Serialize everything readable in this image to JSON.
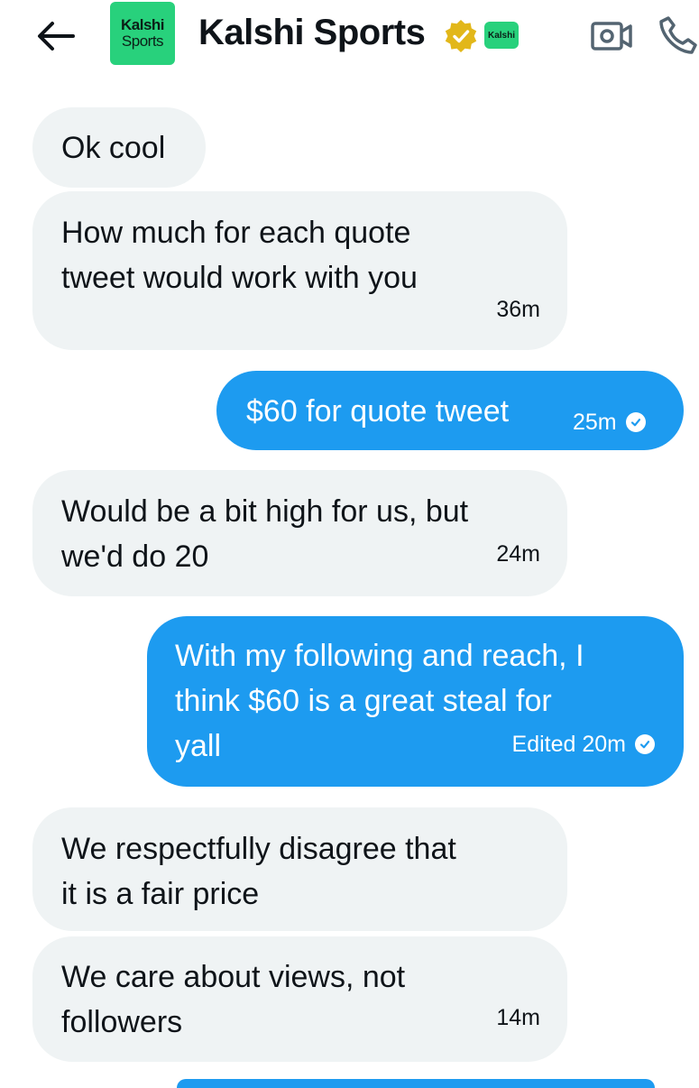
{
  "header": {
    "back_icon": "arrow-left-icon",
    "avatar_line1": "Kalshi",
    "avatar_line2": "Sports",
    "title": "Kalshi Sports",
    "verified_icon": "gold-verified-badge-icon",
    "affiliate_label": "Kalshi",
    "video_icon": "video-call-icon",
    "phone_icon": "phone-icon"
  },
  "colors": {
    "incoming_bubble": "#eff3f4",
    "outgoing_bubble": "#1d9bf0",
    "avatar_green": "#28d17c",
    "verified_gold": "#e2b719"
  },
  "messages": [
    {
      "direction": "incoming",
      "text": "Ok cool"
    },
    {
      "direction": "incoming",
      "text": "How much for each quote\ntweet would work with you",
      "time": "36m"
    },
    {
      "direction": "outgoing",
      "text": "$60 for quote tweet",
      "time": "25m"
    },
    {
      "direction": "incoming",
      "text": "Would be a bit high for us, but\nwe'd do 20",
      "time": "24m"
    },
    {
      "direction": "outgoing",
      "text": "With my following and reach, I\nthink $60 is a great steal for\nyall",
      "time": "Edited 20m"
    },
    {
      "direction": "incoming",
      "text": "We respectfully disagree that\nit is a fair price"
    },
    {
      "direction": "incoming",
      "text": "We care about views, not\nfollowers",
      "time": "14m"
    }
  ]
}
